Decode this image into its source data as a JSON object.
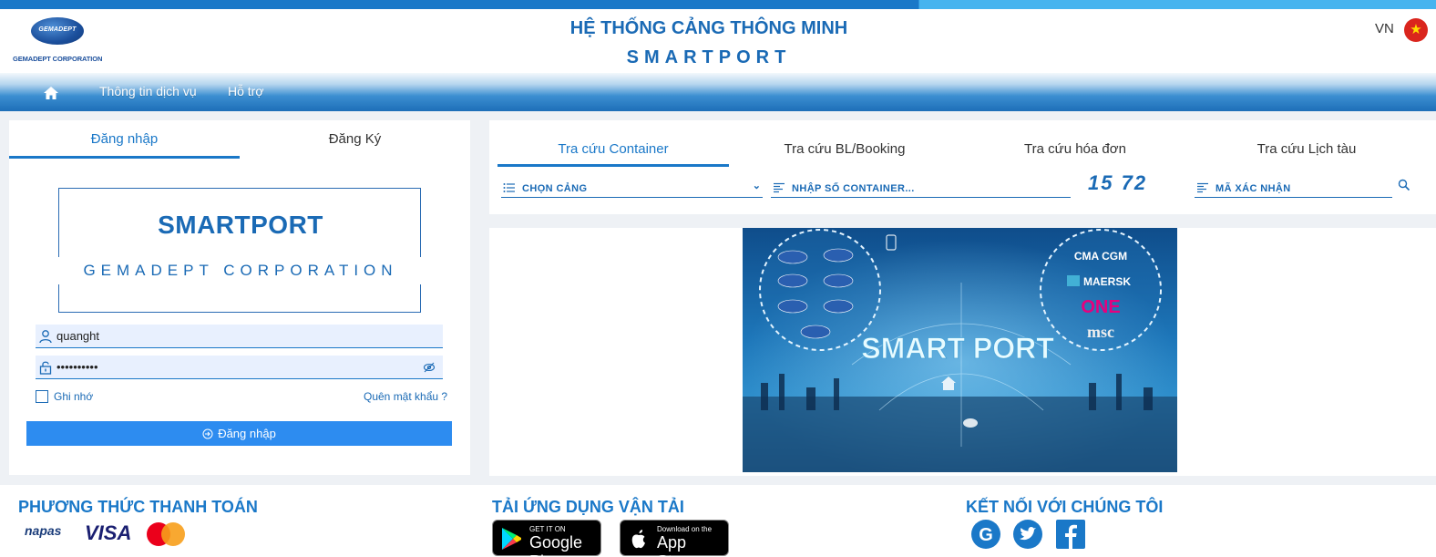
{
  "header": {
    "logo_text": "GEMADEPT",
    "logo_corp": "GEMADEPT CORPORATION",
    "title": "HỆ THỐNG CẢNG THÔNG MINH",
    "subtitle": "SMARTPORT",
    "language": "VN"
  },
  "nav": {
    "items": [
      {
        "label": "Thông tin dịch vụ"
      },
      {
        "label": "Hỗ trợ"
      }
    ]
  },
  "login": {
    "tabs": [
      {
        "label": "Đăng nhập",
        "active": true
      },
      {
        "label": "Đăng Ký",
        "active": false
      }
    ],
    "brand_title": "SMARTPORT",
    "brand_subtitle": "GEMADEPT CORPORATION",
    "username_value": "quanght",
    "password_value": "••••••••••",
    "remember_label": "Ghi nhớ",
    "remember_checked": false,
    "forgot_label": "Quên mật khẩu ?",
    "submit_label": "Đăng nhập"
  },
  "search": {
    "tabs": [
      {
        "label": "Tra cứu Container",
        "active": true
      },
      {
        "label": "Tra cứu BL/Booking",
        "active": false
      },
      {
        "label": "Tra cứu hóa đơn",
        "active": false
      },
      {
        "label": "Tra cứu Lịch tàu",
        "active": false
      }
    ],
    "port_select_label": "CHỌN CẢNG",
    "container_placeholder": "NHẬP SỐ CONTAINER...",
    "captcha_text": "15 72",
    "captcha_placeholder": "MÃ XÁC NHẬN"
  },
  "banner": {
    "text": "SMART PORT",
    "partners": [
      "CMA CGM",
      "MAERSK",
      "ONE",
      "msc"
    ]
  },
  "footer": {
    "payment_heading": "PHƯƠNG THỨC THANH TOÁN",
    "payment_methods": [
      "napas",
      "VISA",
      "MasterCard"
    ],
    "app_heading": "TẢI ỨNG DỤNG VẬN TẢI",
    "google_small": "GET IT ON",
    "google_big": "Google Play",
    "apple_small": "Download on the",
    "apple_big": "App Store",
    "social_heading": "KẾT NỐI VỚI CHÚNG TÔI",
    "social_icons": [
      "google-icon",
      "twitter-icon",
      "facebook-icon"
    ]
  },
  "colors": {
    "primary": "#1a78c8",
    "button": "#2d8cf0",
    "input_bg": "#e8f0fe"
  }
}
